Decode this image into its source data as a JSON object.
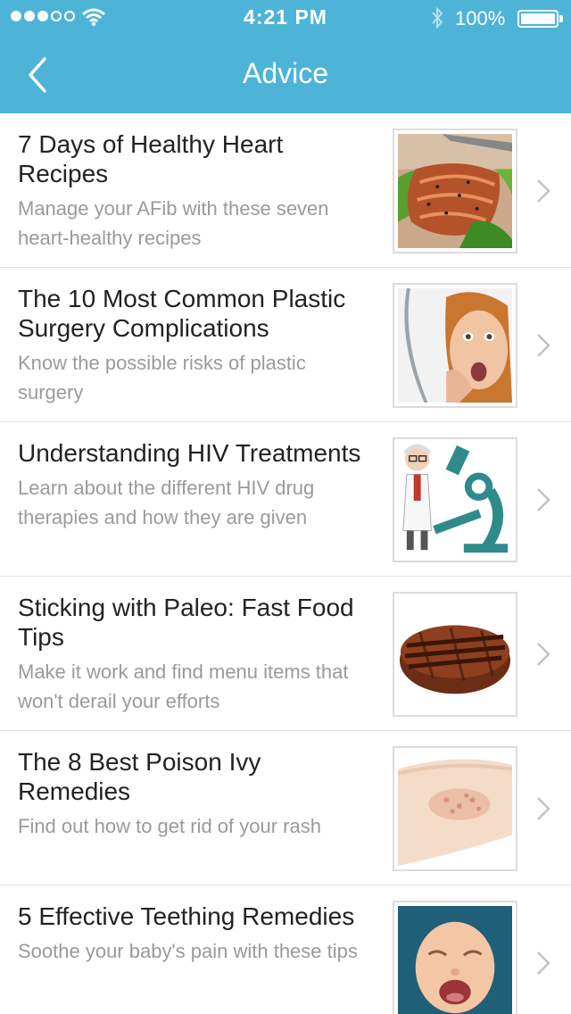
{
  "status_bar": {
    "time": "4:21 PM",
    "battery_percent": "100%",
    "signal_bars_filled": 3,
    "signal_bars_total": 5
  },
  "nav": {
    "title": "Advice",
    "back_icon": "chevron-left-icon"
  },
  "colors": {
    "nav_background": "#4db4d7",
    "title_text": "#222222",
    "subtitle_text": "#9a9a9a"
  },
  "articles": [
    {
      "title": "7 Days of Healthy Heart Recipes",
      "subtitle": "Manage your AFib with these seven heart-healthy recipes",
      "image": "salmon-salad"
    },
    {
      "title": "The 10 Most Common Plastic Surgery Complications",
      "subtitle": "Know the possible risks of plastic surgery",
      "image": "worried-woman"
    },
    {
      "title": "Understanding HIV Treatments",
      "subtitle": "Learn about the different HIV drug therapies and how they are given",
      "image": "doctor-microscope"
    },
    {
      "title": "Sticking with Paleo: Fast Food Tips",
      "subtitle": "Make it work and find menu items that won't derail your efforts",
      "image": "grilled-patty"
    },
    {
      "title": "The 8 Best Poison Ivy Remedies",
      "subtitle": "Find out how to get rid of your rash",
      "image": "rash-arm"
    },
    {
      "title": "5 Effective Teething Remedies",
      "subtitle": "Soothe your baby's pain with these tips",
      "image": "crying-baby"
    }
  ]
}
